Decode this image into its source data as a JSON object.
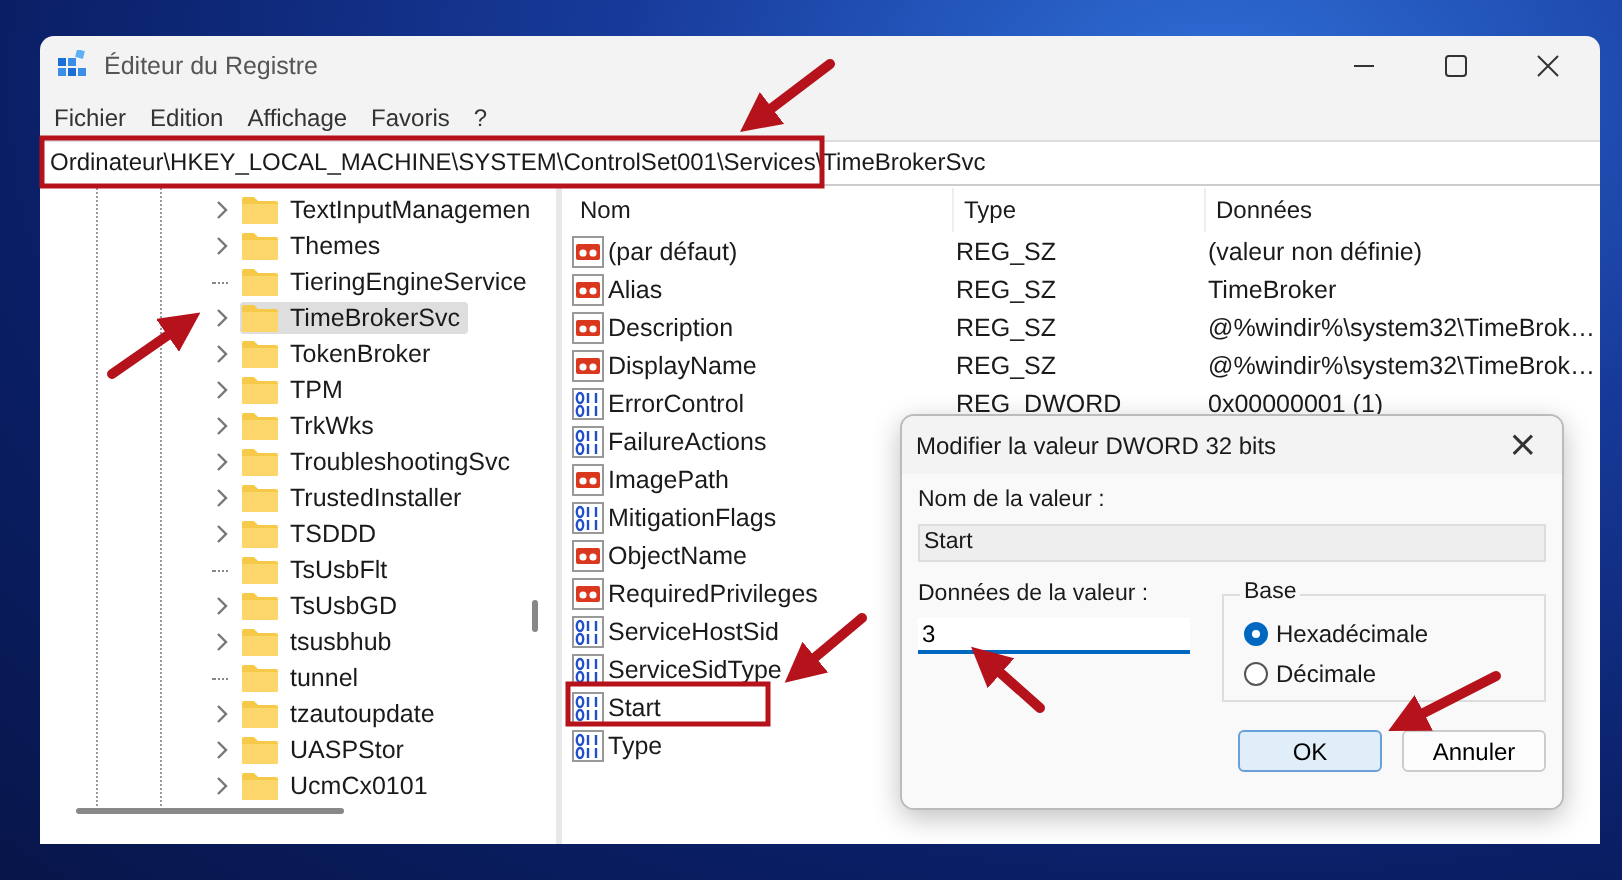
{
  "window": {
    "title": "Éditeur du Registre"
  },
  "menu": [
    "Fichier",
    "Edition",
    "Affichage",
    "Favoris",
    "?"
  ],
  "address": "Ordinateur\\HKEY_LOCAL_MACHINE\\SYSTEM\\ControlSet001\\Services\\TimeBrokerSvc",
  "tree": [
    {
      "label": "TextInputManagemen",
      "has_children": true,
      "selected": false
    },
    {
      "label": "Themes",
      "has_children": true,
      "selected": false
    },
    {
      "label": "TieringEngineService",
      "has_children": false,
      "selected": false
    },
    {
      "label": "TimeBrokerSvc",
      "has_children": true,
      "selected": true
    },
    {
      "label": "TokenBroker",
      "has_children": true,
      "selected": false
    },
    {
      "label": "TPM",
      "has_children": true,
      "selected": false
    },
    {
      "label": "TrkWks",
      "has_children": true,
      "selected": false
    },
    {
      "label": "TroubleshootingSvc",
      "has_children": true,
      "selected": false
    },
    {
      "label": "TrustedInstaller",
      "has_children": true,
      "selected": false
    },
    {
      "label": "TSDDD",
      "has_children": true,
      "selected": false
    },
    {
      "label": "TsUsbFlt",
      "has_children": false,
      "selected": false
    },
    {
      "label": "TsUsbGD",
      "has_children": true,
      "selected": false
    },
    {
      "label": "tsusbhub",
      "has_children": true,
      "selected": false
    },
    {
      "label": "tunnel",
      "has_children": false,
      "selected": false
    },
    {
      "label": "tzautoupdate",
      "has_children": true,
      "selected": false
    },
    {
      "label": "UASPStor",
      "has_children": true,
      "selected": false
    },
    {
      "label": "UcmCx0101",
      "has_children": true,
      "selected": false
    }
  ],
  "columns": [
    "Nom",
    "Type",
    "Données"
  ],
  "values": [
    {
      "kind": "sz",
      "name": "(par défaut)",
      "type": "REG_SZ",
      "data": "(valeur non définie)"
    },
    {
      "kind": "sz",
      "name": "Alias",
      "type": "REG_SZ",
      "data": "TimeBroker"
    },
    {
      "kind": "sz",
      "name": "Description",
      "type": "REG_SZ",
      "data": "@%windir%\\system32\\TimeBrok…"
    },
    {
      "kind": "sz",
      "name": "DisplayName",
      "type": "REG_SZ",
      "data": "@%windir%\\system32\\TimeBrok…"
    },
    {
      "kind": "dword",
      "name": "ErrorControl",
      "type": "REG_DWORD",
      "data": "0x00000001 (1)"
    },
    {
      "kind": "dword",
      "name": "FailureActions"
    },
    {
      "kind": "sz",
      "name": "ImagePath"
    },
    {
      "kind": "dword",
      "name": "MitigationFlags"
    },
    {
      "kind": "sz",
      "name": "ObjectName"
    },
    {
      "kind": "sz",
      "name": "RequiredPrivileges"
    },
    {
      "kind": "dword",
      "name": "ServiceHostSid"
    },
    {
      "kind": "dword",
      "name": "ServiceSidType"
    },
    {
      "kind": "dword",
      "name": "Start"
    },
    {
      "kind": "dword",
      "name": "Type"
    }
  ],
  "dialog": {
    "title": "Modifier la valeur DWORD 32 bits",
    "close": "×",
    "name_label": "Nom de la valeur :",
    "name_value": "Start",
    "data_label": "Données de la valeur :",
    "data_value": "3",
    "base_label": "Base",
    "bases": [
      {
        "label": "Hexadécimale",
        "selected": true
      },
      {
        "label": "Décimale",
        "selected": false
      }
    ],
    "buttons": [
      {
        "label": "OK",
        "default": true
      },
      {
        "label": "Annuler",
        "default": false
      }
    ]
  }
}
